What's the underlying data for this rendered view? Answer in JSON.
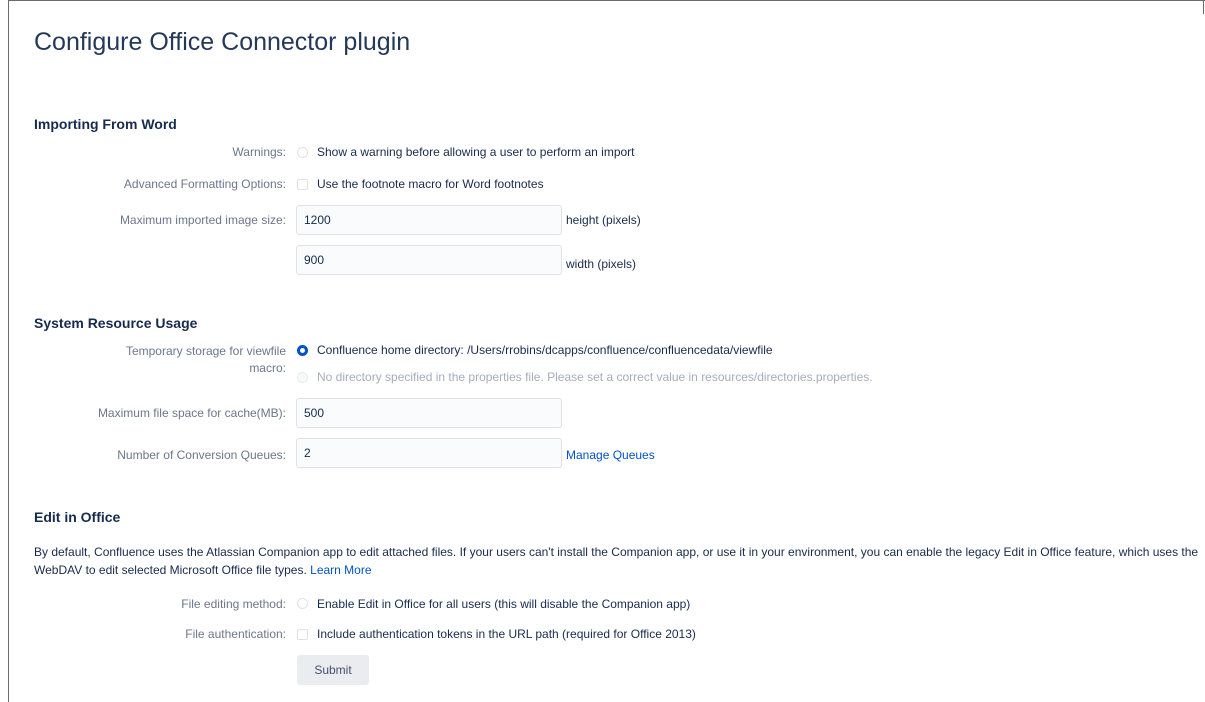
{
  "page_title": "Configure Office Connector plugin",
  "importing": {
    "title": "Importing From Word",
    "warnings_label": "Warnings:",
    "warnings_option": "Show a warning before allowing a user to perform an import",
    "advanced_label": "Advanced Formatting Options:",
    "advanced_option": "Use the footnote macro for Word footnotes",
    "max_image_label": "Maximum imported image size:",
    "height_value": "1200",
    "height_unit": "height (pixels)",
    "width_value": "900",
    "width_unit": "width (pixels)"
  },
  "system": {
    "title": "System Resource Usage",
    "temp_storage_label": "Temporary storage for viewfile macro:",
    "temp_option_home": "Confluence home directory: /Users/rrobins/dcapps/confluence/confluencedata/viewfile",
    "temp_option_none": "No directory specified in the properties file. Please set a correct value in resources/directories.properties.",
    "max_cache_label": "Maximum file space for cache(MB):",
    "max_cache_value": "500",
    "queues_label": "Number of Conversion Queues:",
    "queues_value": "2",
    "manage_queues_link": "Manage Queues"
  },
  "edit_office": {
    "title": "Edit in Office",
    "description": "By default, Confluence uses the Atlassian Companion app to edit attached files. If your users can't install the Companion app, or use it in your environment, you can enable the legacy Edit in Office feature, which uses the WebDAV to edit selected Microsoft Office file types.",
    "learn_more_link": "Learn More",
    "editing_method_label": "File editing method:",
    "editing_method_option": "Enable Edit in Office for all users (this will disable the Companion app)",
    "auth_label": "File authentication:",
    "auth_option": "Include authentication tokens in the URL path (required for Office 2013)"
  },
  "submit_label": "Submit",
  "colors": {
    "link": "#0052cc",
    "label": "#6b778c",
    "text": "#172b4d",
    "radio_selected": "#0052cc",
    "button_bg": "#ebecf0"
  }
}
